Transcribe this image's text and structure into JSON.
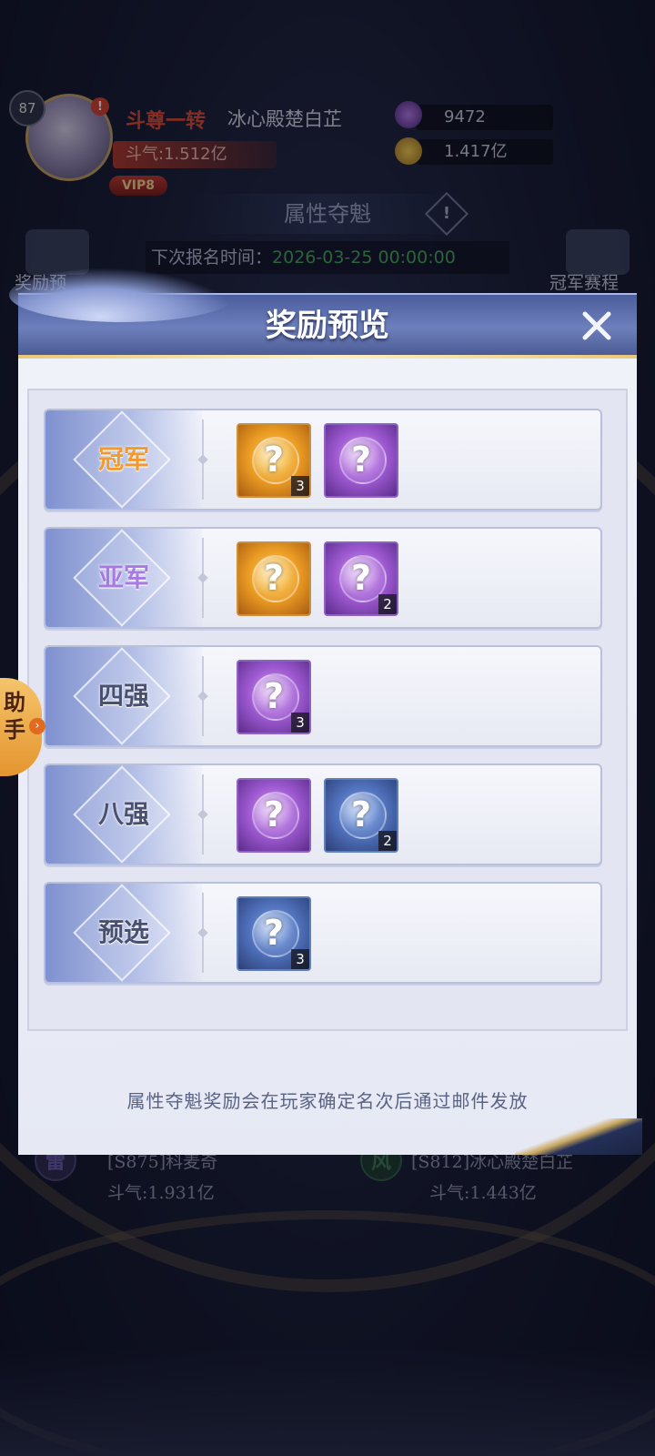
{
  "player": {
    "level": "87",
    "alert": "!",
    "rank_title": "斗尊一转",
    "name": "冰心殿楚白芷",
    "power": "斗气:1.512亿",
    "vip": "VIP8"
  },
  "resources": [
    {
      "icon": "purple-gem-icon",
      "value": "9472"
    },
    {
      "icon": "gold-coin-icon",
      "value": "1.417亿"
    }
  ],
  "event": {
    "title": "属性夺魁",
    "info_icon": "!",
    "signup_label": "下次报名时间：",
    "signup_time": "2026-03-25  00:00:00"
  },
  "side": {
    "left_label": "奖励预",
    "right_label": "冠军赛程"
  },
  "matchups": [
    {
      "element": "雷",
      "name": "[S875]科麦奇",
      "power": "斗气:1.931亿",
      "color": "#6b5aa8"
    },
    {
      "element": "风",
      "name": "[S812]冰心殿楚白芷",
      "power": "斗气:1.443亿",
      "color": "#3c7a52"
    }
  ],
  "assistant": {
    "label_line1": "助",
    "label_line2": "手",
    "arrow": "›"
  },
  "modal": {
    "title": "奖励预览",
    "close_icon": "close-icon",
    "footer": "属性夺魁奖励会在玩家确定名次后通过邮件发放",
    "rows": [
      {
        "rank": "冠军",
        "rank_color": "#f29a2e",
        "items": [
          {
            "type": "gold",
            "icon": "gold-mystery-box-icon",
            "symbol": "?",
            "qty": "3"
          },
          {
            "type": "purple",
            "icon": "purple-mystery-box-icon",
            "symbol": "?",
            "qty": ""
          }
        ]
      },
      {
        "rank": "亚军",
        "rank_color": "#a67ae0",
        "items": [
          {
            "type": "gold",
            "icon": "gold-mystery-box-icon",
            "symbol": "?",
            "qty": ""
          },
          {
            "type": "purple",
            "icon": "purple-mystery-box-icon",
            "symbol": "?",
            "qty": "2"
          }
        ]
      },
      {
        "rank": "四强",
        "rank_color": "#4a5070",
        "items": [
          {
            "type": "purple",
            "icon": "purple-mystery-box-icon",
            "symbol": "?",
            "qty": "3"
          }
        ]
      },
      {
        "rank": "八强",
        "rank_color": "#4a5070",
        "items": [
          {
            "type": "purple",
            "icon": "purple-mystery-box-icon",
            "symbol": "?",
            "qty": ""
          },
          {
            "type": "blue",
            "icon": "blue-mystery-box-icon",
            "symbol": "?",
            "qty": "2"
          }
        ]
      },
      {
        "rank": "预选",
        "rank_color": "#4a5070",
        "items": [
          {
            "type": "blue",
            "icon": "blue-mystery-box-icon",
            "symbol": "?",
            "qty": "3"
          }
        ]
      }
    ]
  }
}
